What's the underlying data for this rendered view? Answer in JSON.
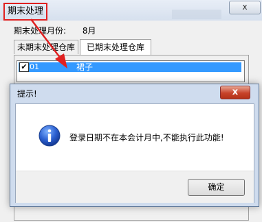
{
  "window": {
    "title": "期末处理",
    "bg_close_glyph": "x"
  },
  "period": {
    "label": "期末处理月份:",
    "value": "8月"
  },
  "tabs": [
    {
      "label": "未期末处理仓库"
    },
    {
      "label": "已期末处理仓库"
    }
  ],
  "list": {
    "rows": [
      {
        "checked": true,
        "check_glyph": "✔",
        "code": "01",
        "name": "裙子"
      }
    ]
  },
  "dialog": {
    "title": "提示!",
    "close_glyph": "x",
    "message": "登录日期不在本会计月中,不能执行此功能!",
    "ok_label": "确定",
    "icon": "info-icon"
  },
  "colors": {
    "annotation_red": "#e02020",
    "selection_blue": "#3399ff",
    "dialog_close_red": "#c7422a"
  }
}
